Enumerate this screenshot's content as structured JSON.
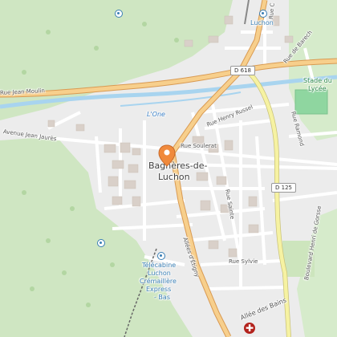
{
  "map": {
    "town_label": [
      "Bagnères-de-",
      "Luchon"
    ],
    "station_label": "Luchon",
    "river_label": "L'One",
    "roads": {
      "d618": "D 618",
      "d125": "D 125"
    },
    "streets": {
      "rue_jean_moulin": "Rue Jean Moulin",
      "avenue_jean_jaures": "Avenue Jean Jaurès",
      "rue_henry_russel": "Rue Henry Russel",
      "rue_soulerat": "Rue Soulerat",
      "rue_sainte": "Rue Sainte",
      "rue_sylvie": "Rue Sylvie",
      "allees_detigny": "Allées d'Étigny",
      "allee_des_bains": "Allée des Bains",
      "rue_de_barech": "Rue de Barech",
      "rue_ramond": "Rue Ramond",
      "boulevard_henri_de_gorsse": "Boulevard Henri de Gorsse",
      "rue_c": "Rue C"
    },
    "poi": {
      "stadium": [
        "Stade du",
        "Lycée"
      ],
      "telecabine": [
        "Télécabine",
        "Luchon",
        "Crémaillère",
        "Express",
        "- Bas"
      ]
    },
    "marker_icon": "map-pin-icon",
    "hospital_icon": "hospital-cross-icon",
    "hospital_symbol": "✚",
    "colors": {
      "forest": "#cfe6c2",
      "town": "#ececec",
      "primary_road": "#f7cf8c",
      "yellow_road": "#f6f2a2",
      "water": "#a8d4ef",
      "marker": "#f08a3c",
      "pitch": "#8fd6a0"
    }
  }
}
